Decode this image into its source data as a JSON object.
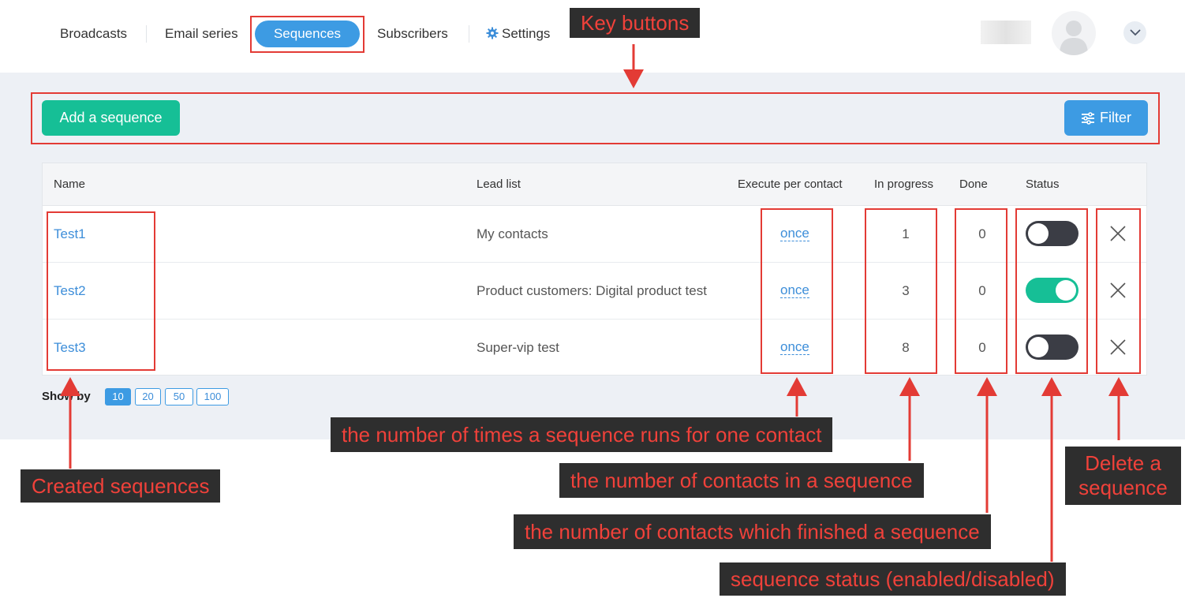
{
  "nav": {
    "items": [
      {
        "label": "Broadcasts"
      },
      {
        "label": "Email series"
      },
      {
        "label": "Sequences"
      },
      {
        "label": "Subscribers"
      },
      {
        "label": "Settings"
      }
    ]
  },
  "toolbar": {
    "add_label": "Add a sequence",
    "filter_label": "Filter"
  },
  "table": {
    "headers": {
      "name": "Name",
      "lead_list": "Lead list",
      "execute": "Execute per contact",
      "in_progress": "In progress",
      "done": "Done",
      "status": "Status"
    },
    "rows": [
      {
        "name": "Test1",
        "lead_list": "My contacts",
        "execute": "once",
        "in_progress": "1",
        "done": "0",
        "status": "disabled"
      },
      {
        "name": "Test2",
        "lead_list": "Product customers: Digital product test",
        "execute": "once",
        "in_progress": "3",
        "done": "0",
        "status": "enabled"
      },
      {
        "name": "Test3",
        "lead_list": "Super-vip test",
        "execute": "once",
        "in_progress": "8",
        "done": "0",
        "status": "disabled"
      }
    ]
  },
  "pagination": {
    "show_by_label": "Show by",
    "options": [
      "10",
      "20",
      "50",
      "100"
    ],
    "selected": "10"
  },
  "annotations": {
    "key_buttons": "Key buttons",
    "created_sequences": "Created sequences",
    "times_runs": "the number of times a sequence runs for one contact",
    "contacts_in": "the number of contacts in a sequence",
    "contacts_finished": "the number of contacts which finished a sequence",
    "status": "sequence status (enabled/disabled)",
    "delete": "Delete a sequence"
  },
  "colors": {
    "accent_blue": "#3d9be3",
    "accent_green": "#16bf96",
    "toggle_off": "#3b3d45",
    "annotation_red": "#e33b35",
    "annotation_bg": "#2e2e2e"
  },
  "icons": [
    "gear-icon",
    "avatar-icon",
    "chevron-down-icon",
    "filter-icon",
    "close-icon"
  ]
}
